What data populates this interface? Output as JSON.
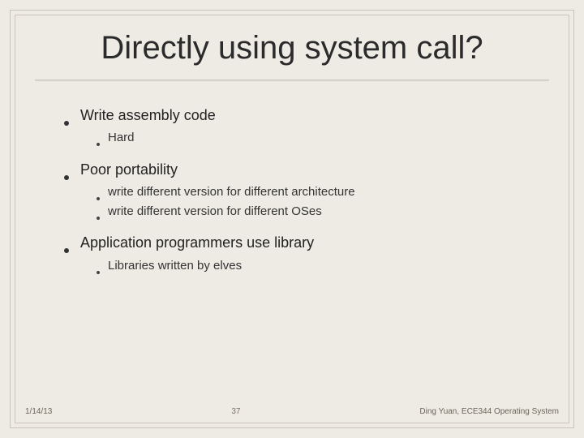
{
  "title": "Directly using system call?",
  "bullets": {
    "b1": {
      "text": "Write assembly code",
      "sub": {
        "s1": "Hard"
      }
    },
    "b2": {
      "text": "Poor portability",
      "sub": {
        "s1": "write different version for different architecture",
        "s2": "write different version for different OSes"
      }
    },
    "b3": {
      "text": "Application programmers use library",
      "sub": {
        "s1": "Libraries written by elves"
      }
    }
  },
  "footer": {
    "date": "1/14/13",
    "page": "37",
    "author": "Ding Yuan, ECE344 Operating System"
  }
}
